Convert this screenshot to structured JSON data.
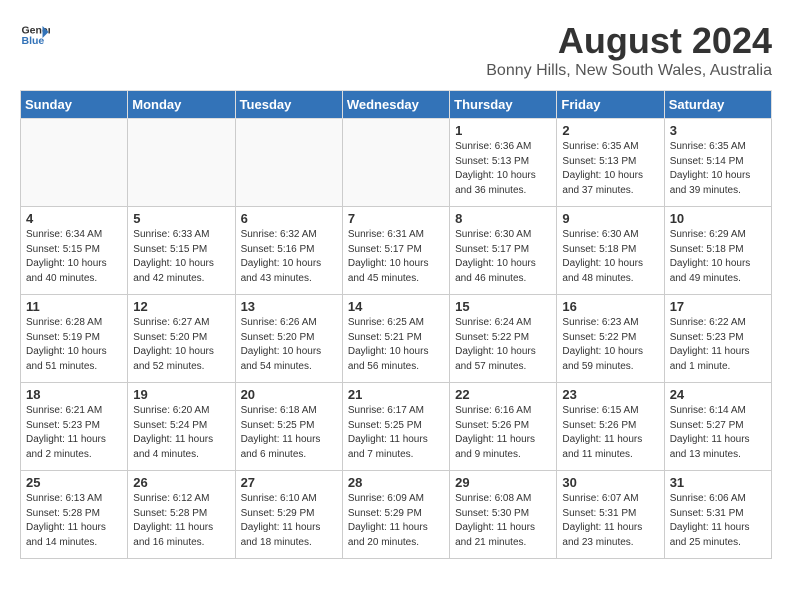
{
  "header": {
    "logo_line1": "General",
    "logo_line2": "Blue",
    "month_year": "August 2024",
    "location": "Bonny Hills, New South Wales, Australia"
  },
  "weekdays": [
    "Sunday",
    "Monday",
    "Tuesday",
    "Wednesday",
    "Thursday",
    "Friday",
    "Saturday"
  ],
  "weeks": [
    [
      {
        "day": "",
        "info": ""
      },
      {
        "day": "",
        "info": ""
      },
      {
        "day": "",
        "info": ""
      },
      {
        "day": "",
        "info": ""
      },
      {
        "day": "1",
        "info": "Sunrise: 6:36 AM\nSunset: 5:13 PM\nDaylight: 10 hours\nand 36 minutes."
      },
      {
        "day": "2",
        "info": "Sunrise: 6:35 AM\nSunset: 5:13 PM\nDaylight: 10 hours\nand 37 minutes."
      },
      {
        "day": "3",
        "info": "Sunrise: 6:35 AM\nSunset: 5:14 PM\nDaylight: 10 hours\nand 39 minutes."
      }
    ],
    [
      {
        "day": "4",
        "info": "Sunrise: 6:34 AM\nSunset: 5:15 PM\nDaylight: 10 hours\nand 40 minutes."
      },
      {
        "day": "5",
        "info": "Sunrise: 6:33 AM\nSunset: 5:15 PM\nDaylight: 10 hours\nand 42 minutes."
      },
      {
        "day": "6",
        "info": "Sunrise: 6:32 AM\nSunset: 5:16 PM\nDaylight: 10 hours\nand 43 minutes."
      },
      {
        "day": "7",
        "info": "Sunrise: 6:31 AM\nSunset: 5:17 PM\nDaylight: 10 hours\nand 45 minutes."
      },
      {
        "day": "8",
        "info": "Sunrise: 6:30 AM\nSunset: 5:17 PM\nDaylight: 10 hours\nand 46 minutes."
      },
      {
        "day": "9",
        "info": "Sunrise: 6:30 AM\nSunset: 5:18 PM\nDaylight: 10 hours\nand 48 minutes."
      },
      {
        "day": "10",
        "info": "Sunrise: 6:29 AM\nSunset: 5:18 PM\nDaylight: 10 hours\nand 49 minutes."
      }
    ],
    [
      {
        "day": "11",
        "info": "Sunrise: 6:28 AM\nSunset: 5:19 PM\nDaylight: 10 hours\nand 51 minutes."
      },
      {
        "day": "12",
        "info": "Sunrise: 6:27 AM\nSunset: 5:20 PM\nDaylight: 10 hours\nand 52 minutes."
      },
      {
        "day": "13",
        "info": "Sunrise: 6:26 AM\nSunset: 5:20 PM\nDaylight: 10 hours\nand 54 minutes."
      },
      {
        "day": "14",
        "info": "Sunrise: 6:25 AM\nSunset: 5:21 PM\nDaylight: 10 hours\nand 56 minutes."
      },
      {
        "day": "15",
        "info": "Sunrise: 6:24 AM\nSunset: 5:22 PM\nDaylight: 10 hours\nand 57 minutes."
      },
      {
        "day": "16",
        "info": "Sunrise: 6:23 AM\nSunset: 5:22 PM\nDaylight: 10 hours\nand 59 minutes."
      },
      {
        "day": "17",
        "info": "Sunrise: 6:22 AM\nSunset: 5:23 PM\nDaylight: 11 hours\nand 1 minute."
      }
    ],
    [
      {
        "day": "18",
        "info": "Sunrise: 6:21 AM\nSunset: 5:23 PM\nDaylight: 11 hours\nand 2 minutes."
      },
      {
        "day": "19",
        "info": "Sunrise: 6:20 AM\nSunset: 5:24 PM\nDaylight: 11 hours\nand 4 minutes."
      },
      {
        "day": "20",
        "info": "Sunrise: 6:18 AM\nSunset: 5:25 PM\nDaylight: 11 hours\nand 6 minutes."
      },
      {
        "day": "21",
        "info": "Sunrise: 6:17 AM\nSunset: 5:25 PM\nDaylight: 11 hours\nand 7 minutes."
      },
      {
        "day": "22",
        "info": "Sunrise: 6:16 AM\nSunset: 5:26 PM\nDaylight: 11 hours\nand 9 minutes."
      },
      {
        "day": "23",
        "info": "Sunrise: 6:15 AM\nSunset: 5:26 PM\nDaylight: 11 hours\nand 11 minutes."
      },
      {
        "day": "24",
        "info": "Sunrise: 6:14 AM\nSunset: 5:27 PM\nDaylight: 11 hours\nand 13 minutes."
      }
    ],
    [
      {
        "day": "25",
        "info": "Sunrise: 6:13 AM\nSunset: 5:28 PM\nDaylight: 11 hours\nand 14 minutes."
      },
      {
        "day": "26",
        "info": "Sunrise: 6:12 AM\nSunset: 5:28 PM\nDaylight: 11 hours\nand 16 minutes."
      },
      {
        "day": "27",
        "info": "Sunrise: 6:10 AM\nSunset: 5:29 PM\nDaylight: 11 hours\nand 18 minutes."
      },
      {
        "day": "28",
        "info": "Sunrise: 6:09 AM\nSunset: 5:29 PM\nDaylight: 11 hours\nand 20 minutes."
      },
      {
        "day": "29",
        "info": "Sunrise: 6:08 AM\nSunset: 5:30 PM\nDaylight: 11 hours\nand 21 minutes."
      },
      {
        "day": "30",
        "info": "Sunrise: 6:07 AM\nSunset: 5:31 PM\nDaylight: 11 hours\nand 23 minutes."
      },
      {
        "day": "31",
        "info": "Sunrise: 6:06 AM\nSunset: 5:31 PM\nDaylight: 11 hours\nand 25 minutes."
      }
    ]
  ]
}
